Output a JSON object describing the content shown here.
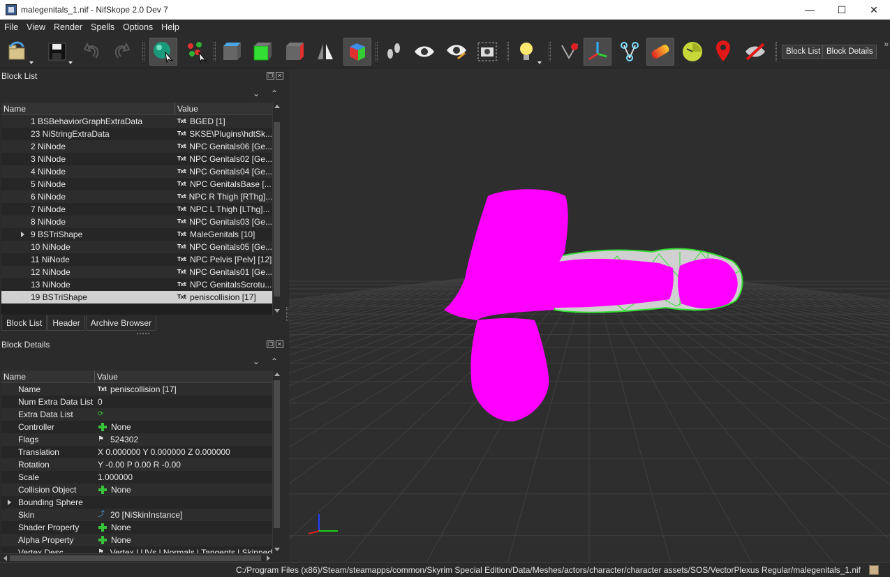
{
  "window": {
    "title": "malegenitals_1.nif - NifSkope 2.0 Dev 7",
    "minimize": "—",
    "maximize": "☐",
    "close": "✕"
  },
  "menu": [
    "File",
    "View",
    "Render",
    "Spells",
    "Options",
    "Help"
  ],
  "toolbar": {
    "block_list_btn": "Block List",
    "block_details_btn": "Block Details",
    "more": "»",
    "icons": [
      "load-icon",
      "save-icon",
      "undo-icon",
      "redo-icon",
      "select-object-icon",
      "select-vertex-icon",
      "view-top-icon",
      "view-front-icon",
      "view-side-icon",
      "view-flip-icon",
      "view-perspective-icon",
      "walk-mode-icon",
      "show-icon",
      "show-hidden-icon",
      "screenshot-icon",
      "lighting-icon",
      "show-vertices-icon",
      "show-axes-icon",
      "show-nodes-icon",
      "show-collision-icon",
      "show-constraints-icon",
      "show-markers-icon",
      "hide-icon"
    ]
  },
  "block_list": {
    "title": "Block List",
    "col_name": "Name",
    "col_value": "Value",
    "rows": [
      {
        "name": "1 BSBehaviorGraphExtraData",
        "value": "BGED [1]"
      },
      {
        "name": "23 NiStringExtraData",
        "value": "SKSE\\Plugins\\hdtSk..."
      },
      {
        "name": "2 NiNode",
        "value": "NPC Genitals06 [Ge..."
      },
      {
        "name": "3 NiNode",
        "value": "NPC Genitals02 [Ge..."
      },
      {
        "name": "4 NiNode",
        "value": "NPC Genitals04 [Ge..."
      },
      {
        "name": "5 NiNode",
        "value": "NPC GenitalsBase [..."
      },
      {
        "name": "6 NiNode",
        "value": "NPC R Thigh [RThg]..."
      },
      {
        "name": "7 NiNode",
        "value": "NPC L Thigh [LThg]..."
      },
      {
        "name": "8 NiNode",
        "value": "NPC Genitals03 [Ge..."
      },
      {
        "name": "9 BSTriShape",
        "value": "MaleGenitals [10]"
      },
      {
        "name": "10 NiNode",
        "value": "NPC Genitals05 [Ge..."
      },
      {
        "name": "11 NiNode",
        "value": "NPC Pelvis [Pelv] [12]"
      },
      {
        "name": "12 NiNode",
        "value": "NPC Genitals01 [Ge..."
      },
      {
        "name": "13 NiNode",
        "value": "NPC GenitalsScrotu..."
      },
      {
        "name": "19 BSTriShape",
        "value": "peniscollision [17]"
      }
    ],
    "tabs": [
      "Block List",
      "Header",
      "Archive Browser"
    ]
  },
  "block_details": {
    "title": "Block Details",
    "col_name": "Name",
    "col_value": "Value",
    "rows": [
      {
        "name": "Name",
        "value": "peniscollision [17]",
        "icon": "txt"
      },
      {
        "name": "Num Extra Data List",
        "value": "0",
        "icon": ""
      },
      {
        "name": "Extra Data List",
        "value": "",
        "icon": "refresh"
      },
      {
        "name": "Controller",
        "value": "None",
        "icon": "plus"
      },
      {
        "name": "Flags",
        "value": "524302",
        "icon": "flag"
      },
      {
        "name": "Translation",
        "value": "X 0.000000 Y 0.000000 Z 0.000000",
        "icon": ""
      },
      {
        "name": "Rotation",
        "value": "Y -0.00 P 0.00 R -0.00",
        "icon": ""
      },
      {
        "name": "Scale",
        "value": "1.000000",
        "icon": ""
      },
      {
        "name": "Collision Object",
        "value": "None",
        "icon": "plus"
      },
      {
        "name": "Bounding Sphere",
        "value": "",
        "icon": ""
      },
      {
        "name": "Skin",
        "value": "20 [NiSkinInstance]",
        "icon": "link"
      },
      {
        "name": "Shader Property",
        "value": "None",
        "icon": "plus"
      },
      {
        "name": "Alpha Property",
        "value": "None",
        "icon": "plus"
      },
      {
        "name": "Vertex Desc",
        "value": "Vertex | UVs | Normals | Tangents | Skinned",
        "icon": "flag"
      }
    ]
  },
  "status": {
    "path": "C:/Program Files (x86)/Steam/steamapps/common/Skyrim Special Edition/Data/Meshes/actors/character/character assets/SOS/VectorPlexus Regular/malegenitals_1.nif"
  },
  "colors": {
    "mesh": "#ff00ff",
    "wireframe": "#33dd33",
    "grid": "#3f3f3f",
    "background": "#2e2e2e"
  }
}
